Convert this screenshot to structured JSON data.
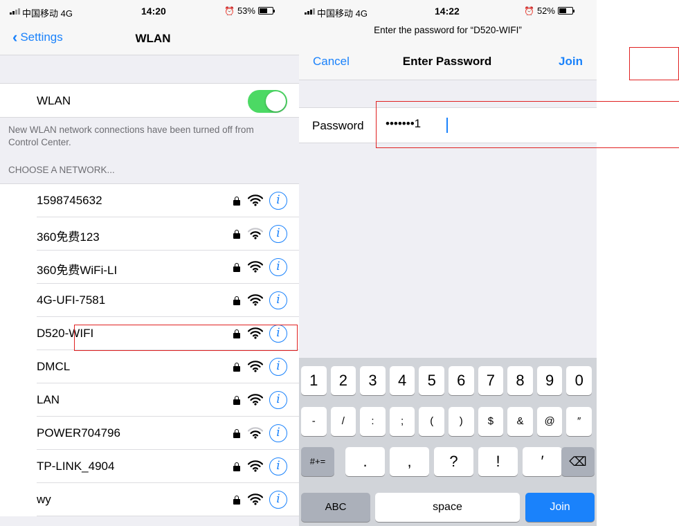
{
  "left_screen": {
    "status": {
      "carrier": "中国移动",
      "network": "4G",
      "time": "14:20",
      "battery": "53%",
      "battery_level": 0.53
    },
    "nav": {
      "back_label": "Settings",
      "title": "WLAN"
    },
    "wlan": {
      "label": "WLAN",
      "toggle_on": true,
      "toggle_color": "#4cd964"
    },
    "note": "New WLAN network connections have been turned off from Control Center.",
    "section_header": "CHOOSE A NETWORK...",
    "networks": [
      {
        "name": "1598745632",
        "secured": true,
        "signal": 3
      },
      {
        "name": "360免费123",
        "secured": true,
        "signal": 2
      },
      {
        "name": "360免费WiFi-LI",
        "secured": true,
        "signal": 3
      },
      {
        "name": "4G-UFI-7581",
        "secured": true,
        "signal": 3
      },
      {
        "name": "D520-WIFI",
        "secured": true,
        "signal": 3
      },
      {
        "name": "DMCL",
        "secured": true,
        "signal": 3
      },
      {
        "name": "LAN",
        "secured": true,
        "signal": 3
      },
      {
        "name": "POWER704796",
        "secured": true,
        "signal": 2
      },
      {
        "name": "TP-LINK_4904",
        "secured": true,
        "signal": 3
      },
      {
        "name": "wy",
        "secured": true,
        "signal": 3
      }
    ],
    "info_glyph": "i"
  },
  "right_screen": {
    "status": {
      "carrier": "中国移动",
      "network": "4G",
      "time": "14:22",
      "battery": "52%",
      "battery_level": 0.52
    },
    "prompt": "Enter the password for “D520-WIFI”",
    "nav": {
      "cancel_label": "Cancel",
      "title": "Enter Password",
      "join_label": "Join"
    },
    "password": {
      "label": "Password",
      "value": "•••••••1"
    },
    "keyboard": {
      "row1": [
        "1",
        "2",
        "3",
        "4",
        "5",
        "6",
        "7",
        "8",
        "9",
        "0"
      ],
      "row2": [
        "-",
        "/",
        ":",
        ";",
        "(",
        ")",
        "$",
        "&",
        "@",
        "″"
      ],
      "row3": {
        "mode": "#+=",
        "keys": [
          ".",
          ",",
          "?",
          "!",
          "′"
        ],
        "backspace": "⌫"
      },
      "row4": {
        "abc": "ABC",
        "space": "space",
        "join": "Join"
      }
    }
  },
  "colors": {
    "accent": "#1a82fb",
    "annotation": "#e02020",
    "keyboard_bg": "#d1d4d9"
  },
  "icons": {
    "back": "chevron-left-icon",
    "lock": "lock-icon",
    "wifi": "wifi-icon",
    "info": "info-icon",
    "alarm": "alarm-icon",
    "battery": "battery-icon",
    "signal": "cellular-signal-icon",
    "backspace": "backspace-icon"
  }
}
